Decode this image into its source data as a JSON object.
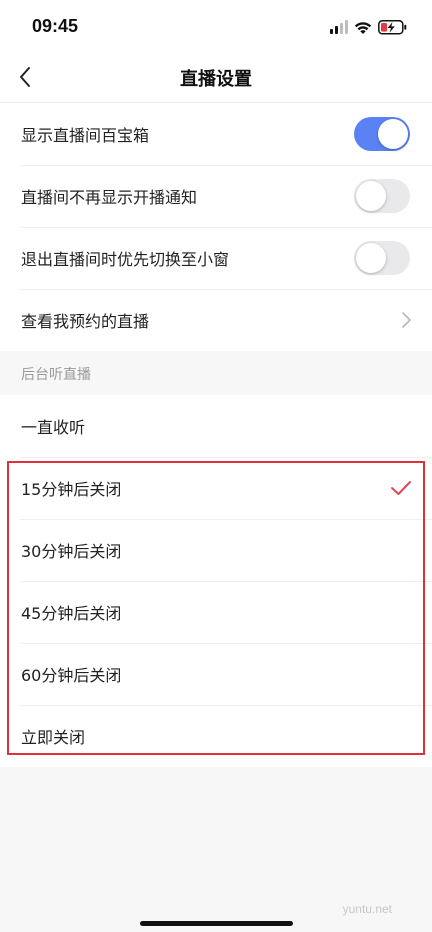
{
  "status_bar": {
    "time": "09:45",
    "icons": [
      "cellular-signal-icon",
      "wifi-icon",
      "battery-charging-icon"
    ]
  },
  "nav": {
    "title": "直播设置",
    "back_icon": "chevron-left-icon"
  },
  "settings": [
    {
      "label": "显示直播间百宝箱",
      "control": "toggle",
      "state": "on"
    },
    {
      "label": "直播间不再显示开播通知",
      "control": "toggle",
      "state": "off"
    },
    {
      "label": "退出直播间时优先切换至小窗",
      "control": "toggle",
      "state": "off"
    },
    {
      "label": "查看我预约的直播",
      "control": "chevron-right-icon"
    }
  ],
  "background_listen": {
    "header": "后台听直播",
    "options": [
      {
        "label": "一直收听",
        "selected": false
      },
      {
        "label": "15分钟后关闭",
        "selected": true
      },
      {
        "label": "30分钟后关闭",
        "selected": false
      },
      {
        "label": "45分钟后关闭",
        "selected": false
      },
      {
        "label": "60分钟后关闭",
        "selected": false
      },
      {
        "label": "立即关闭",
        "selected": false
      }
    ]
  },
  "colors": {
    "toggle_on": "#5b82f5",
    "toggle_off": "#e9e9eb",
    "check_mark": "#e0485a",
    "highlight_border": "#e0303a"
  },
  "watermark": "yuntu.net"
}
